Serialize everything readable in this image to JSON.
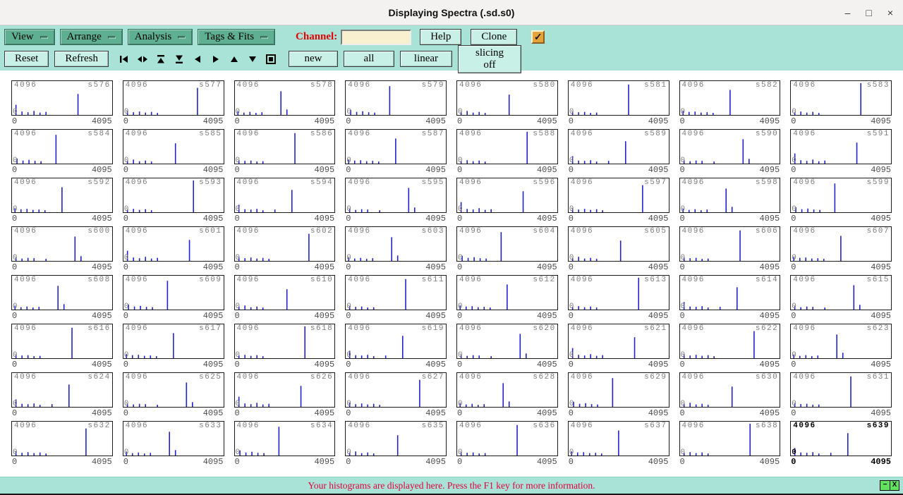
{
  "window": {
    "title": "Displaying Spectra (.sd.s0)",
    "minimize_icon": "–",
    "maximize_icon": "□",
    "close_icon": "×"
  },
  "menubar": {
    "menus": [
      {
        "label": "View"
      },
      {
        "label": "Arrange"
      },
      {
        "label": "Analysis"
      },
      {
        "label": "Tags & Fits"
      }
    ],
    "channel_label": "Channel:",
    "channel_value": "",
    "help_label": "Help",
    "clone_label": "Clone",
    "checkbox_checked": true,
    "check_icon": "✓"
  },
  "toolbar": {
    "reset_label": "Reset",
    "refresh_label": "Refresh",
    "nav_icon_names": [
      "go-first-icon",
      "expand-horizontal-icon",
      "go-top-icon",
      "go-bottom-icon",
      "go-left-icon",
      "go-right-icon",
      "go-up-icon",
      "go-down-icon",
      "full-view-icon"
    ],
    "new_label": "new",
    "all_label": "all",
    "linear_label": "linear",
    "slicing_label": "slicing off"
  },
  "statusbar": {
    "message": "Your histograms are displayed here. Press the F1 key for more information.",
    "minimize_icon": "−",
    "close_icon": "X"
  },
  "colors": {
    "toolbar_bg": "#a9e3d8",
    "menu_button": "#5fb093",
    "button_light": "#c9f0e6",
    "accent_check": "#e5a33b",
    "histogram": "#2222cc",
    "status_text": "#e0003c",
    "channel_text": "#e40000",
    "panel_label": "#7d7d7d"
  },
  "grid": {
    "ymax_label": "4096",
    "yzero_label": "0",
    "xmin_label": "0",
    "xmax_label": "4095",
    "patterns": [
      [
        4,
        30,
        10,
        10,
        16,
        8,
        22,
        12,
        28,
        7,
        34,
        9,
        66,
        62
      ],
      [
        4,
        12,
        10,
        8,
        16,
        10,
        22,
        7,
        28,
        9,
        34,
        6,
        74,
        80
      ],
      [
        3,
        10,
        9,
        7,
        15,
        9,
        21,
        6,
        27,
        8,
        46,
        70,
        52,
        16
      ],
      [
        5,
        15,
        11,
        9,
        17,
        11,
        23,
        8,
        29,
        7,
        44,
        85
      ],
      [
        4,
        9,
        10,
        12,
        16,
        7,
        22,
        9,
        28,
        6,
        52,
        60
      ],
      [
        4,
        10,
        10,
        8,
        16,
        9,
        22,
        6,
        28,
        7,
        60,
        90
      ],
      [
        3,
        12,
        9,
        9,
        15,
        10,
        21,
        7,
        27,
        8,
        33,
        6,
        50,
        74
      ],
      [
        4,
        8,
        10,
        10,
        16,
        7,
        22,
        9,
        28,
        6,
        70,
        94
      ],
      [
        4,
        22,
        10,
        9,
        16,
        8,
        22,
        10,
        28,
        6,
        40,
        8,
        57,
        66
      ],
      [
        4,
        10,
        10,
        7,
        16,
        9,
        22,
        8,
        34,
        6,
        63,
        72,
        69,
        14
      ]
    ],
    "spectra": [
      {
        "label": "s576",
        "p": 0
      },
      {
        "label": "s577",
        "p": 1
      },
      {
        "label": "s578",
        "p": 2
      },
      {
        "label": "s579",
        "p": 3
      },
      {
        "label": "s580",
        "p": 4
      },
      {
        "label": "s581",
        "p": 5
      },
      {
        "label": "s582",
        "p": 6
      },
      {
        "label": "s583",
        "p": 7
      },
      {
        "label": "s584",
        "p": 3
      },
      {
        "label": "s585",
        "p": 4
      },
      {
        "label": "s586",
        "p": 5
      },
      {
        "label": "s587",
        "p": 6
      },
      {
        "label": "s588",
        "p": 7
      },
      {
        "label": "s589",
        "p": 8
      },
      {
        "label": "s590",
        "p": 9
      },
      {
        "label": "s591",
        "p": 0
      },
      {
        "label": "s592",
        "p": 6
      },
      {
        "label": "s593",
        "p": 7
      },
      {
        "label": "s594",
        "p": 8
      },
      {
        "label": "s595",
        "p": 9
      },
      {
        "label": "s596",
        "p": 0
      },
      {
        "label": "s597",
        "p": 1
      },
      {
        "label": "s598",
        "p": 2
      },
      {
        "label": "s599",
        "p": 3
      },
      {
        "label": "s600",
        "p": 9
      },
      {
        "label": "s601",
        "p": 0
      },
      {
        "label": "s602",
        "p": 1
      },
      {
        "label": "s603",
        "p": 2
      },
      {
        "label": "s604",
        "p": 3
      },
      {
        "label": "s605",
        "p": 4
      },
      {
        "label": "s606",
        "p": 5
      },
      {
        "label": "s607",
        "p": 6
      },
      {
        "label": "s608",
        "p": 2
      },
      {
        "label": "s609",
        "p": 3
      },
      {
        "label": "s610",
        "p": 4
      },
      {
        "label": "s611",
        "p": 5
      },
      {
        "label": "s612",
        "p": 6
      },
      {
        "label": "s613",
        "p": 7
      },
      {
        "label": "s614",
        "p": 8
      },
      {
        "label": "s615",
        "p": 9
      },
      {
        "label": "s616",
        "p": 5
      },
      {
        "label": "s617",
        "p": 6
      },
      {
        "label": "s618",
        "p": 7
      },
      {
        "label": "s619",
        "p": 8
      },
      {
        "label": "s620",
        "p": 9
      },
      {
        "label": "s621",
        "p": 0
      },
      {
        "label": "s622",
        "p": 1
      },
      {
        "label": "s623",
        "p": 2
      },
      {
        "label": "s624",
        "p": 8
      },
      {
        "label": "s625",
        "p": 9
      },
      {
        "label": "s626",
        "p": 0
      },
      {
        "label": "s627",
        "p": 1
      },
      {
        "label": "s628",
        "p": 2
      },
      {
        "label": "s629",
        "p": 3
      },
      {
        "label": "s630",
        "p": 4
      },
      {
        "label": "s631",
        "p": 5
      },
      {
        "label": "s632",
        "p": 1
      },
      {
        "label": "s633",
        "p": 2
      },
      {
        "label": "s634",
        "p": 3
      },
      {
        "label": "s635",
        "p": 4
      },
      {
        "label": "s636",
        "p": 5
      },
      {
        "label": "s637",
        "p": 6
      },
      {
        "label": "s638",
        "p": 7
      },
      {
        "label": "s639",
        "p": 8,
        "selected": true
      }
    ]
  }
}
